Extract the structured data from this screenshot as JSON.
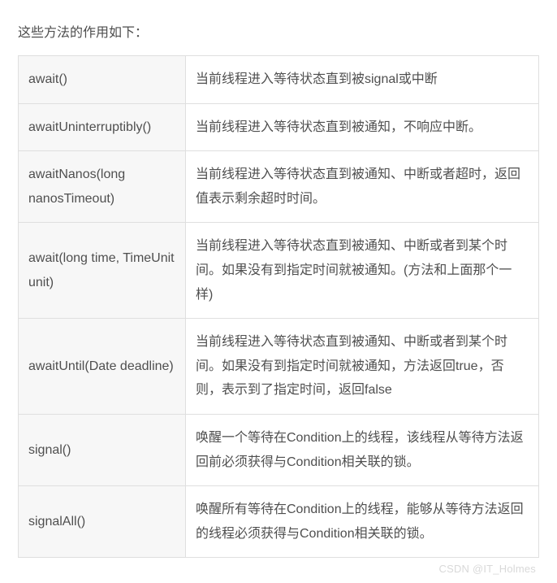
{
  "intro": "这些方法的作用如下：",
  "rows": [
    {
      "method": "await()",
      "desc": "当前线程进入等待状态直到被signal或中断"
    },
    {
      "method": "awaitUninterruptibly()",
      "desc": "当前线程进入等待状态直到被通知，不响应中断。"
    },
    {
      "method": "awaitNanos(long nanosTimeout)",
      "desc": "当前线程进入等待状态直到被通知、中断或者超时，返回值表示剩余超时时间。"
    },
    {
      "method": "await(long time, TimeUnit unit)",
      "desc": "当前线程进入等待状态直到被通知、中断或者到某个时间。如果没有到指定时间就被通知。(方法和上面那个一样)"
    },
    {
      "method": "awaitUntil(Date deadline)",
      "desc": "当前线程进入等待状态直到被通知、中断或者到某个时间。如果没有到指定时间就被通知，方法返回true，否则，表示到了指定时间，返回false"
    },
    {
      "method": "signal()",
      "desc": "唤醒一个等待在Condition上的线程，该线程从等待方法返回前必须获得与Condition相关联的锁。"
    },
    {
      "method": "signalAll()",
      "desc": "唤醒所有等待在Condition上的线程，能够从等待方法返回的线程必须获得与Condition相关联的锁。"
    }
  ],
  "watermark": "CSDN @IT_Holmes"
}
